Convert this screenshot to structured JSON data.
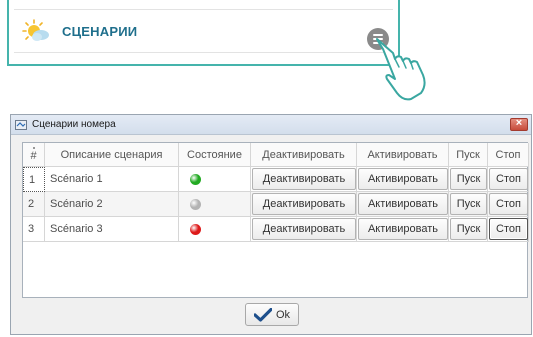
{
  "top": {
    "title": "СЦЕНАРИИ"
  },
  "window": {
    "title": "Сценарии номера",
    "close_label": "×"
  },
  "table": {
    "columns": [
      "#",
      "Описание сценария",
      "Состояние",
      "Деактивировать",
      "Активировать",
      "Пуск",
      "Стоп"
    ],
    "rows": [
      {
        "num": "1",
        "description": "Scénario 1",
        "state": "active",
        "state_color": "#22aa22",
        "deactivate": "Деактивировать",
        "activate": "Активировать",
        "start": "Пуск",
        "stop": "Стоп"
      },
      {
        "num": "2",
        "description": "Scénario 2",
        "state": "inactive",
        "state_color": "#b3b3b3",
        "deactivate": "Деактивировать",
        "activate": "Активировать",
        "start": "Пуск",
        "stop": "Стоп"
      },
      {
        "num": "3",
        "description": "Scénario 3",
        "state": "error",
        "state_color": "#dd1a1a",
        "deactivate": "Деактивировать",
        "activate": "Активировать",
        "start": "Пуск",
        "stop": "Стоп"
      }
    ]
  },
  "ok_label": "Ok",
  "colors": {
    "accent_teal": "#45b4ac",
    "title_blue": "#1f6f8c",
    "ok_check": "#1d4f8c"
  },
  "icons": {
    "top_left": "sun-cloud-icon",
    "menu": "hamburger-menu-icon",
    "pointer": "pointing-hand-icon",
    "window": "window-app-icon",
    "close": "close-icon",
    "ok": "checkmark-icon"
  }
}
